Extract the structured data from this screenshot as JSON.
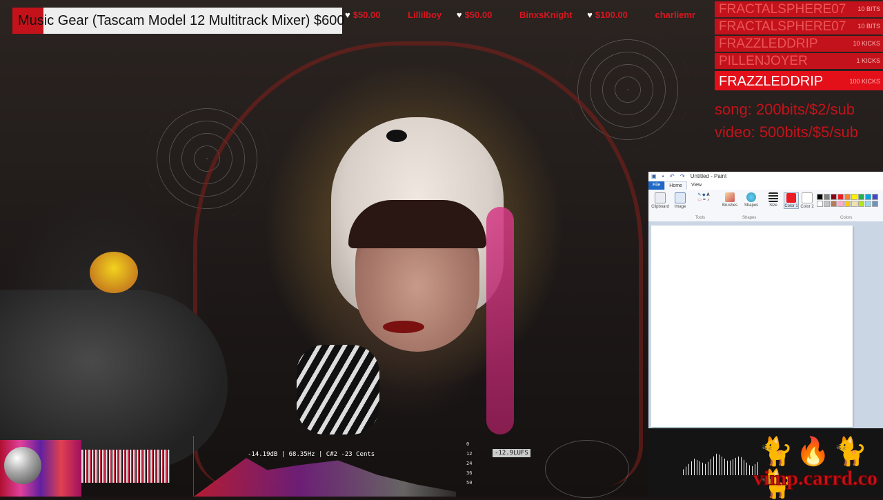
{
  "alert": {
    "text": "Music Gear (Tascam Model 12 Multitrack Mixer) $600"
  },
  "ticker": [
    {
      "name": "",
      "amount": "$50.00"
    },
    {
      "name": "Lillilboy",
      "amount": "$50.00"
    },
    {
      "name": "BinxsKnight",
      "amount": "$100.00"
    },
    {
      "name": "charliemr",
      "amount": ""
    }
  ],
  "leaderboard": [
    {
      "name": "FRACTALSPHERE07",
      "amount": "10 BITS"
    },
    {
      "name": "FRACTALSPHERE07",
      "amount": "10 BITS"
    },
    {
      "name": "FRAZZLEDDRIP",
      "amount": "10 KICKS"
    },
    {
      "name": "PILLENJOYER",
      "amount": "1 KICKS"
    },
    {
      "name": "FRAZZLEDDRIP",
      "amount": "100 KICKS"
    }
  ],
  "rates": {
    "song": "song: 200bits/$2/sub",
    "video": "video: 500bits/$5/sub"
  },
  "paint": {
    "title": "Untitled - Paint",
    "tabs": [
      "File",
      "Home",
      "View"
    ],
    "tools": {
      "clipboard": "Clipboard",
      "image": "Image",
      "tools": "Tools",
      "brushes": "Brushes",
      "shapes": "Shapes",
      "size": "Size",
      "color1": "Color 1",
      "color2": "Color 2",
      "colors": "Colors"
    },
    "palette": [
      "#000000",
      "#7f7f7f",
      "#880015",
      "#ed1c24",
      "#ff7f27",
      "#fff200",
      "#22b14c",
      "#00a2e8",
      "#3f48cc",
      "#ffffff",
      "#c3c3c3",
      "#b97a57",
      "#ffaec9",
      "#ffc90e",
      "#efe4b0",
      "#b5e61d",
      "#99d9ea",
      "#7092be"
    ],
    "color1_value": "#ed1c24"
  },
  "audio": {
    "readout": "-14.19dB | 68.35Hz | C#2 -23 Cents",
    "meter_ticks": [
      "0",
      "12",
      "24",
      "36",
      "50"
    ],
    "lufs": "-12.9LUFS"
  },
  "overlay_site": "vimp.carrd.co"
}
